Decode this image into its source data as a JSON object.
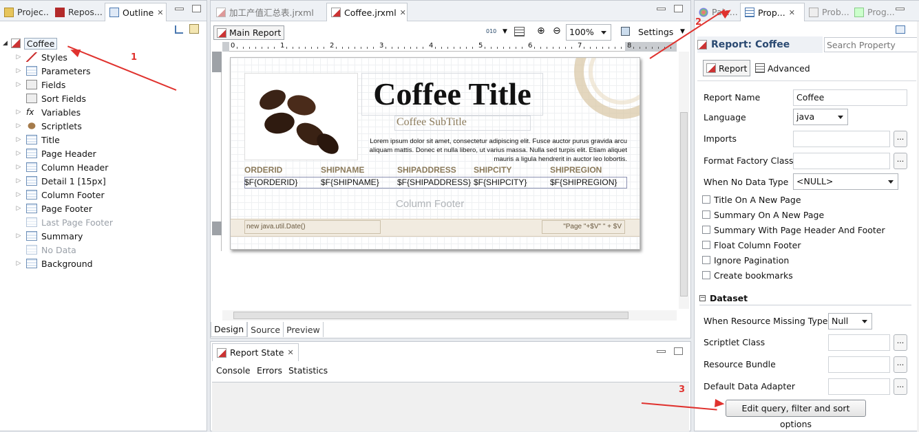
{
  "left_panel": {
    "tabs": [
      {
        "label": "Projec..."
      },
      {
        "label": "Repos..."
      },
      {
        "label": "Outline"
      }
    ],
    "tree": {
      "root": "Coffee",
      "items": [
        "Styles",
        "Parameters",
        "Fields",
        "Sort Fields",
        "Variables",
        "Scriptlets",
        "Title",
        "Page Header",
        "Column Header",
        "Detail 1 [15px]",
        "Column Footer",
        "Page Footer",
        "Last Page Footer",
        "Summary",
        "No Data",
        "Background"
      ]
    }
  },
  "editor": {
    "tabs": [
      {
        "label": "加工产值汇总表.jrxml"
      },
      {
        "label": "Coffee.jrxml"
      }
    ],
    "toolbar": {
      "main_report": "Main Report",
      "zoom": "100%",
      "settings": "Settings"
    },
    "ruler": [
      "0",
      "1",
      "2",
      "3",
      "4",
      "5",
      "6",
      "7",
      "8"
    ],
    "canvas": {
      "title": "Coffee Title",
      "subtitle": "Coffee SubTitle",
      "lorem": "Lorem ipsum dolor sit amet, consectetur adipiscing elit. Fusce auctor purus gravida arcu aliquam mattis. Donec et nulla libero, ut varius massa. Nulla sed turpis elit. Etiam aliquet mauris a ligula hendrerit in auctor leo lobortis.",
      "headers": [
        "ORDERID",
        "SHIPNAME",
        "SHIPADDRESS",
        "SHIPCITY",
        "SHIPREGION"
      ],
      "fields": [
        "$F{ORDERID}",
        "$F{SHIPNAME}",
        "$F{SHIPADDRESS}",
        "$F{SHIPCITY}",
        "$F{SHIPREGION}"
      ],
      "column_footer": "Column Footer",
      "date_expr": "new java.util.Date()",
      "page_expr": "\"Page \"+$V\" \" + $V"
    },
    "bottom_tabs": [
      "Design",
      "Source",
      "Preview"
    ]
  },
  "report_state": {
    "title": "Report State",
    "tabs": [
      "Console",
      "Errors",
      "Statistics"
    ]
  },
  "properties": {
    "tabs": [
      {
        "label": "Pale..."
      },
      {
        "label": "Prop..."
      },
      {
        "label": "Prob..."
      },
      {
        "label": "Prog..."
      }
    ],
    "header": "Report: Coffee",
    "search_placeholder": "Search Property",
    "subtabs": [
      "Report",
      "Advanced"
    ],
    "rows": {
      "report_name_label": "Report Name",
      "report_name": "Coffee",
      "language_label": "Language",
      "language": "java",
      "imports_label": "Imports",
      "format_factory_label": "Format Factory Class",
      "no_data_label": "When No Data Type",
      "no_data": "<NULL>"
    },
    "checkboxes": [
      "Title On A New Page",
      "Summary On A New Page",
      "Summary With Page Header And Footer",
      "Float Column Footer",
      "Ignore Pagination",
      "Create bookmarks"
    ],
    "dataset": {
      "header": "Dataset",
      "missing_label": "When Resource Missing Type",
      "missing": "Null",
      "scriptlet_label": "Scriptlet Class",
      "bundle_label": "Resource Bundle",
      "adapter_label": "Default Data Adapter",
      "edit_button": "Edit query, filter and sort options"
    }
  },
  "annotations": [
    "1",
    "2",
    "3"
  ]
}
